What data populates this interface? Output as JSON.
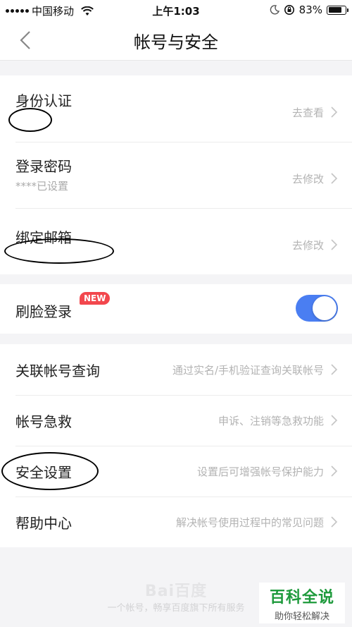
{
  "status_bar": {
    "carrier": "中国移动",
    "time": "上午1:03",
    "battery_percent": "83%",
    "battery_level": 0.83,
    "icons": [
      "signal-icon",
      "wifi-icon",
      "moon-icon",
      "orientation-lock-icon",
      "battery-icon"
    ]
  },
  "nav": {
    "title": "帐号与安全",
    "back_icon": "chevron-left-icon"
  },
  "account_section": {
    "items": [
      {
        "title": "身份认证",
        "subtitle": "",
        "action": "去查看"
      },
      {
        "title": "登录密码",
        "subtitle": "****已设置",
        "action": "去修改"
      },
      {
        "title": "绑定邮箱",
        "subtitle": "",
        "action": "去修改"
      }
    ]
  },
  "face_login": {
    "title": "刷脸登录",
    "badge": "NEW",
    "enabled": true,
    "accent_color": "#4a7ef2"
  },
  "service_section": {
    "items": [
      {
        "title": "关联帐号查询",
        "action": "通过实名/手机验证查询关联帐号"
      },
      {
        "title": "帐号急救",
        "action": "申诉、注销等急救功能"
      },
      {
        "title": "安全设置",
        "action": "设置后可增强帐号保护能力"
      },
      {
        "title": "帮助中心",
        "action": "解决帐号使用过程中的常见问题"
      }
    ]
  },
  "footer": {
    "logo": "Bai百度",
    "text": "一个帐号，畅享百度旗下所有服务"
  },
  "watermark": {
    "main": "百科全说",
    "sub": "助你轻松解决"
  },
  "colors": {
    "background": "#f4f4f6",
    "badge": "#f2474d",
    "watermark_green": "#1e9a3c"
  }
}
